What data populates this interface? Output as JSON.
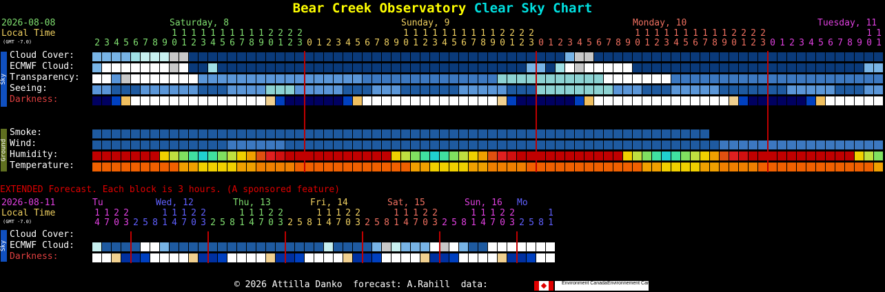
{
  "title": {
    "part1": "Bear Creek Observatory",
    "part2": "Clear Sky Chart"
  },
  "colors": {
    "yellow": "#ffff00",
    "cyan": "#00e0e0",
    "green": "#80e070",
    "orange": "#f0d060",
    "red": "#e00000",
    "salmon": "#f07060",
    "magenta": "#e040e0",
    "blue": "#6060ff"
  },
  "main": {
    "date": "2026-08-08",
    "local_time_label": "Local Time",
    "gmt_label": "(GMT -7.0)",
    "days": [
      {
        "label": "Saturday, 8",
        "color": "#80e070"
      },
      {
        "label": "Sunday, 9",
        "color": "#f0d060"
      },
      {
        "label": "Monday, 10",
        "color": "#f07060"
      },
      {
        "label": "Tuesday, 11",
        "color": "#e040e0"
      }
    ],
    "hours": [
      2,
      3,
      4,
      5,
      6,
      7,
      8,
      9,
      10,
      11,
      12,
      13,
      14,
      15,
      16,
      17,
      18,
      19,
      20,
      21,
      22,
      23,
      0,
      1,
      2,
      3,
      4,
      5,
      6,
      7,
      8,
      9,
      10,
      11,
      12,
      13,
      14,
      15,
      16,
      17,
      18,
      19,
      20,
      21,
      22,
      23,
      0,
      1,
      2,
      3,
      4,
      5,
      6,
      7,
      8,
      9,
      10,
      11,
      12,
      13,
      14,
      15,
      16,
      17,
      18,
      19,
      20,
      21,
      22,
      23,
      0,
      1,
      2,
      3,
      4,
      5,
      6,
      7,
      8,
      9,
      10,
      11
    ],
    "sky_label": "Sky",
    "ground_label": "Ground",
    "sky_rows": [
      {
        "label": "Cloud Cover:",
        "key": "cloud"
      },
      {
        "label": "ECMWF Cloud:",
        "key": "ecmwf"
      },
      {
        "label": "Transparency:",
        "key": "transp"
      },
      {
        "label": "Seeing:",
        "key": "seeing"
      },
      {
        "label": "Darkness:",
        "key": "dark"
      }
    ],
    "ground_rows": [
      {
        "label": "Smoke:",
        "key": "smoke"
      },
      {
        "label": "Wind:",
        "key": "wind"
      },
      {
        "label": "Humidity:",
        "key": "humid"
      },
      {
        "label": "Temperature:",
        "key": "temp"
      }
    ]
  },
  "extended": {
    "banner": "EXTENDED Forecast. Each block is 3 hours. (A sponsored feature)",
    "date": "2026-08-11",
    "local_time_label": "Local Time",
    "gmt_label": "(GMT -7.0)",
    "days": [
      {
        "label": "Tu",
        "color": "#e040e0"
      },
      {
        "label": "Wed, 12",
        "color": "#6060ff"
      },
      {
        "label": "Thu, 13",
        "color": "#80e070"
      },
      {
        "label": "Fri, 14",
        "color": "#f0d060"
      },
      {
        "label": "Sat, 15",
        "color": "#f07060"
      },
      {
        "label": "Sun, 16",
        "color": "#e040e0"
      },
      {
        "label": "Mo",
        "color": "#6060ff"
      }
    ],
    "hours": [
      14,
      17,
      20,
      23,
      2,
      5,
      8,
      11,
      14,
      17,
      20,
      23,
      2,
      5,
      8,
      11,
      14,
      17,
      20,
      23,
      2,
      5,
      8,
      11,
      14,
      17,
      20,
      23,
      2,
      5,
      8,
      11,
      14,
      17,
      20,
      23,
      2,
      5,
      8,
      11,
      14,
      17,
      20,
      23,
      2,
      5,
      8,
      11
    ],
    "rows": [
      {
        "label": "Cloud Cover:",
        "key": "ext_cloud"
      },
      {
        "label": "ECMWF Cloud:",
        "key": "ext_ecmwf"
      },
      {
        "label": "Darkness:",
        "key": "ext_dark"
      }
    ]
  },
  "footer": {
    "text": "© 2026 Attilla Danko  forecast: A.Rahill  data:",
    "agency_en": "Environment Canada",
    "agency_fr": "Environnement Canada"
  }
}
